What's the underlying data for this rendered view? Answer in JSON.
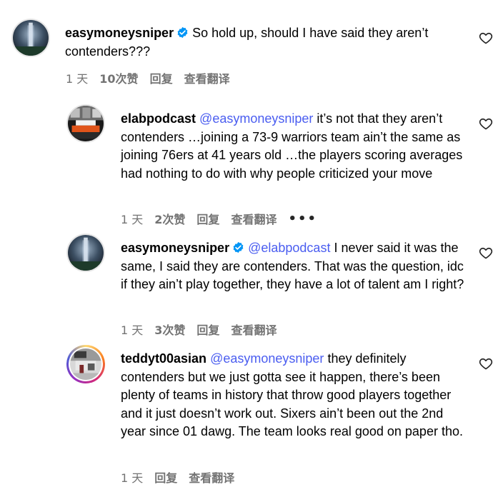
{
  "comments": [
    {
      "username": "easymoneysniper",
      "verified": true,
      "mention": "",
      "text": "So hold up, should I have said they aren’t contenders???",
      "time": "1 天",
      "likes": "10次赞",
      "reply": "回复",
      "translate": "查看翻译",
      "more": ""
    },
    {
      "username": "elabpodcast",
      "verified": false,
      "mention": "@easymoneysniper",
      "text": "it’s not that they aren’t contenders …joining a 73-9 warriors team ain’t the same as joining 76ers at 41 years old …the players scoring averages had nothing to do with why people criticized your move",
      "time": "1 天",
      "likes": "2次赞",
      "reply": "回复",
      "translate": "查看翻译",
      "more": "•••"
    },
    {
      "username": "easymoneysniper",
      "verified": true,
      "mention": "@elabpodcast",
      "text": "I never said it was the same, I said they are contenders. That was the question, idc if they ain’t play together, they have a lot of talent am I right?",
      "time": "1 天",
      "likes": "3次赞",
      "reply": "回复",
      "translate": "查看翻译",
      "more": ""
    },
    {
      "username": "teddyt00asian",
      "verified": false,
      "mention": "@easymoneysniper",
      "text": "they definitely contenders but we just gotta see it happen, there’s been plenty of teams in history that throw good players together and it just doesn’t work out. Sixers ain’t been out the 2nd year since 01 dawg. The team looks real good on paper tho.",
      "time": "1 天",
      "likes": "",
      "reply": "回复",
      "translate": "查看翻译",
      "more": ""
    }
  ],
  "colors": {
    "mention": "#4a5df0",
    "meta": "#737373",
    "verified": "#0095f6"
  }
}
